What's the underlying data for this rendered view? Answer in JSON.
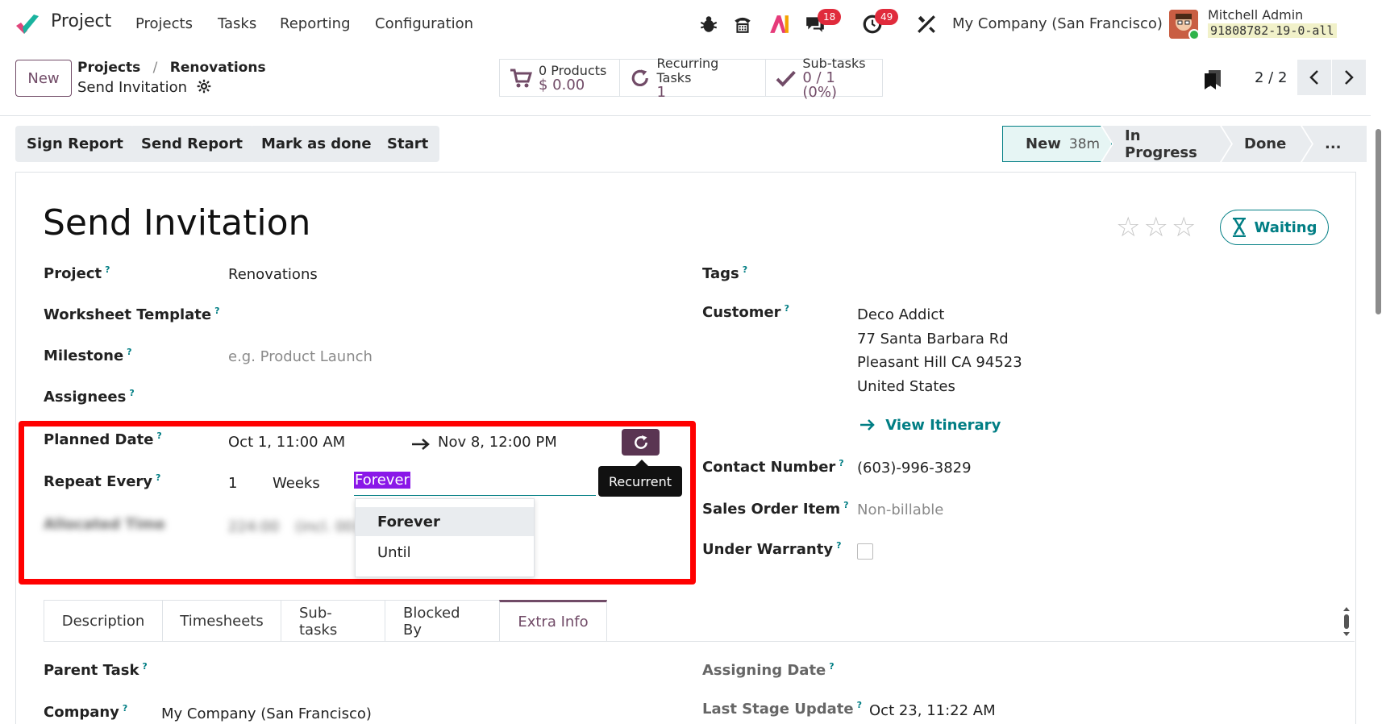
{
  "navbar": {
    "app_name": "Project",
    "menu": [
      "Projects",
      "Tasks",
      "Reporting",
      "Configuration"
    ],
    "chat_badge": "18",
    "activity_badge": "49",
    "company": "My Company (San Francisco)",
    "user_name": "Mitchell Admin",
    "db_name": "91808782-19-0-all"
  },
  "control": {
    "new_label": "New",
    "breadcrumb_parent1": "Projects",
    "breadcrumb_sep": "/",
    "breadcrumb_parent2": "Renovations",
    "breadcrumb_current": "Send Invitation",
    "smart_products_label": "0 Products",
    "smart_products_value": "$ 0.00",
    "smart_recurring_label": "Recurring Tasks",
    "smart_recurring_value": "1",
    "smart_subtasks_label": "Sub-tasks",
    "smart_subtasks_value": "0 / 1 (0%)",
    "pager": "2 / 2"
  },
  "actions": [
    "Sign Report",
    "Send Report",
    "Mark as done",
    "Start"
  ],
  "stages": {
    "new": "New",
    "new_duration": "38m",
    "in_progress": "In Progress",
    "done": "Done",
    "more": "..."
  },
  "form": {
    "title": "Send Invitation",
    "stars": "☆☆☆",
    "waiting": "Waiting",
    "project_label": "Project",
    "project_value": "Renovations",
    "worksheet_label": "Worksheet Template",
    "milestone_label": "Milestone",
    "milestone_placeholder": "e.g. Product Launch",
    "assignees_label": "Assignees",
    "planned_label": "Planned Date",
    "planned_start": "Oct 1, 11:00 AM",
    "planned_end": "Nov 8, 12:00 PM",
    "recurrent_tooltip": "Recurrent",
    "repeat_label": "Repeat Every",
    "repeat_interval": "1",
    "repeat_unit": "Weeks",
    "repeat_type": "Forever",
    "repeat_options": [
      "Forever",
      "Until"
    ],
    "allocated_label": "Allocated Time",
    "allocated_value": "224:00",
    "allocated_extra": "(incl. 00:00",
    "tags_label": "Tags",
    "customer_label": "Customer",
    "customer_address": [
      "Deco Addict",
      "77 Santa Barbara Rd",
      "Pleasant Hill CA 94523",
      "United States"
    ],
    "view_itinerary": "View Itinerary",
    "contact_label": "Contact Number",
    "contact_value": "(603)-996-3829",
    "sale_line_label": "Sales Order Item",
    "sale_line_value": "Non-billable",
    "warranty_label": "Under Warranty"
  },
  "tabs": [
    "Description",
    "Timesheets",
    "Sub-tasks",
    "Blocked By",
    "Extra Info"
  ],
  "extra_info": {
    "parent_label": "Parent Task",
    "company_label": "Company",
    "company_value": "My Company (San Francisco)",
    "assigning_label": "Assigning Date",
    "last_update_label": "Last Stage Update",
    "last_update_value": "Oct 23, 11:22 AM"
  },
  "colors": {
    "brand": "#714b67",
    "accent": "#017e84",
    "highlight": "#ff0000"
  }
}
